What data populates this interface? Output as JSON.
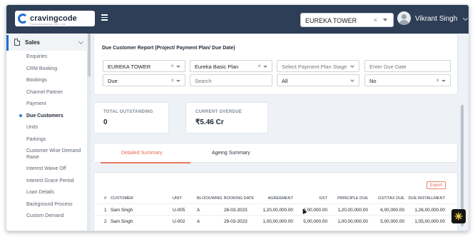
{
  "app": {
    "logo_text": "cravingcode",
    "logo_tagline": "TECHNOLOGIES PVT LTD"
  },
  "header": {
    "project_select_value": "EUREKA TOWER",
    "user_name": "Vikrant Singh"
  },
  "sidebar": {
    "section_label": "Sales",
    "items": [
      {
        "label": "Enquiries"
      },
      {
        "label": "CRM Booking"
      },
      {
        "label": "Bookings"
      },
      {
        "label": "Channel Partner"
      },
      {
        "label": "Payment"
      },
      {
        "label": "Due Customers",
        "active": true
      },
      {
        "label": "Units"
      },
      {
        "label": "Parkings"
      },
      {
        "label": "Customer Wise Demand Raise"
      },
      {
        "label": "Interest Waive Off"
      },
      {
        "label": "Interest Grace Period"
      },
      {
        "label": "Loan Details"
      },
      {
        "label": "Background Process"
      },
      {
        "label": "Custom Demand"
      }
    ]
  },
  "filters": {
    "title": "Due Customer Report (Project/ Payment Plan/ Due Date)",
    "project": "EUREKA TOWER",
    "payment_plan": "Eureka Basic Plan",
    "payment_plan_stage_placeholder": "Select Payment Plan Stage",
    "due_date_placeholder": "Enter Due Date",
    "status": "Due",
    "search_placeholder": "Search",
    "all_select": "All",
    "no_select": "No"
  },
  "stats": {
    "total_outstanding_label": "TOTAL OUTSTANDING",
    "total_outstanding_value": "0",
    "current_overdue_label": "CURRENT OVERDUE",
    "current_overdue_value": "₹5.46 Cr"
  },
  "tabs": {
    "detailed": "Detailed Summary",
    "ageing": "Ageing Summary"
  },
  "table": {
    "export_label": "Export",
    "headers": [
      "#",
      "CUSTOMER",
      "UNIT",
      "BLOCK/WING",
      "BOOKING DATE",
      "AGREEMENT",
      "GST",
      "PRINCIPLE DUE",
      "GST/TAX DUE",
      "DUE INSTALLMENT"
    ],
    "rows": [
      [
        "1",
        "Sam Singh",
        "U-005",
        "A",
        "28-03-2023",
        "1,20,00,000.00",
        "6,00,000.00",
        "1,20,00,000.00",
        "6,00,000.00",
        "1,26,00,000.00"
      ],
      [
        "2",
        "Sam Singh",
        "U-002",
        "A",
        "29-03-2023",
        "1,00,00,000.00",
        "5,00,000.00",
        "1,00,00,000.00",
        "5,00,000.00",
        "1,05,00,000.00"
      ]
    ]
  },
  "icons": {
    "hamburger": "hamburger-icon",
    "document": "document-icon",
    "avatar": "user-avatar-icon",
    "fab": "settings-spark-icon"
  },
  "colors": {
    "topbar": "#2e3e57",
    "accent": "#1f6fd1",
    "tab_active": "#e26a4f",
    "export": "#e26a4f"
  }
}
